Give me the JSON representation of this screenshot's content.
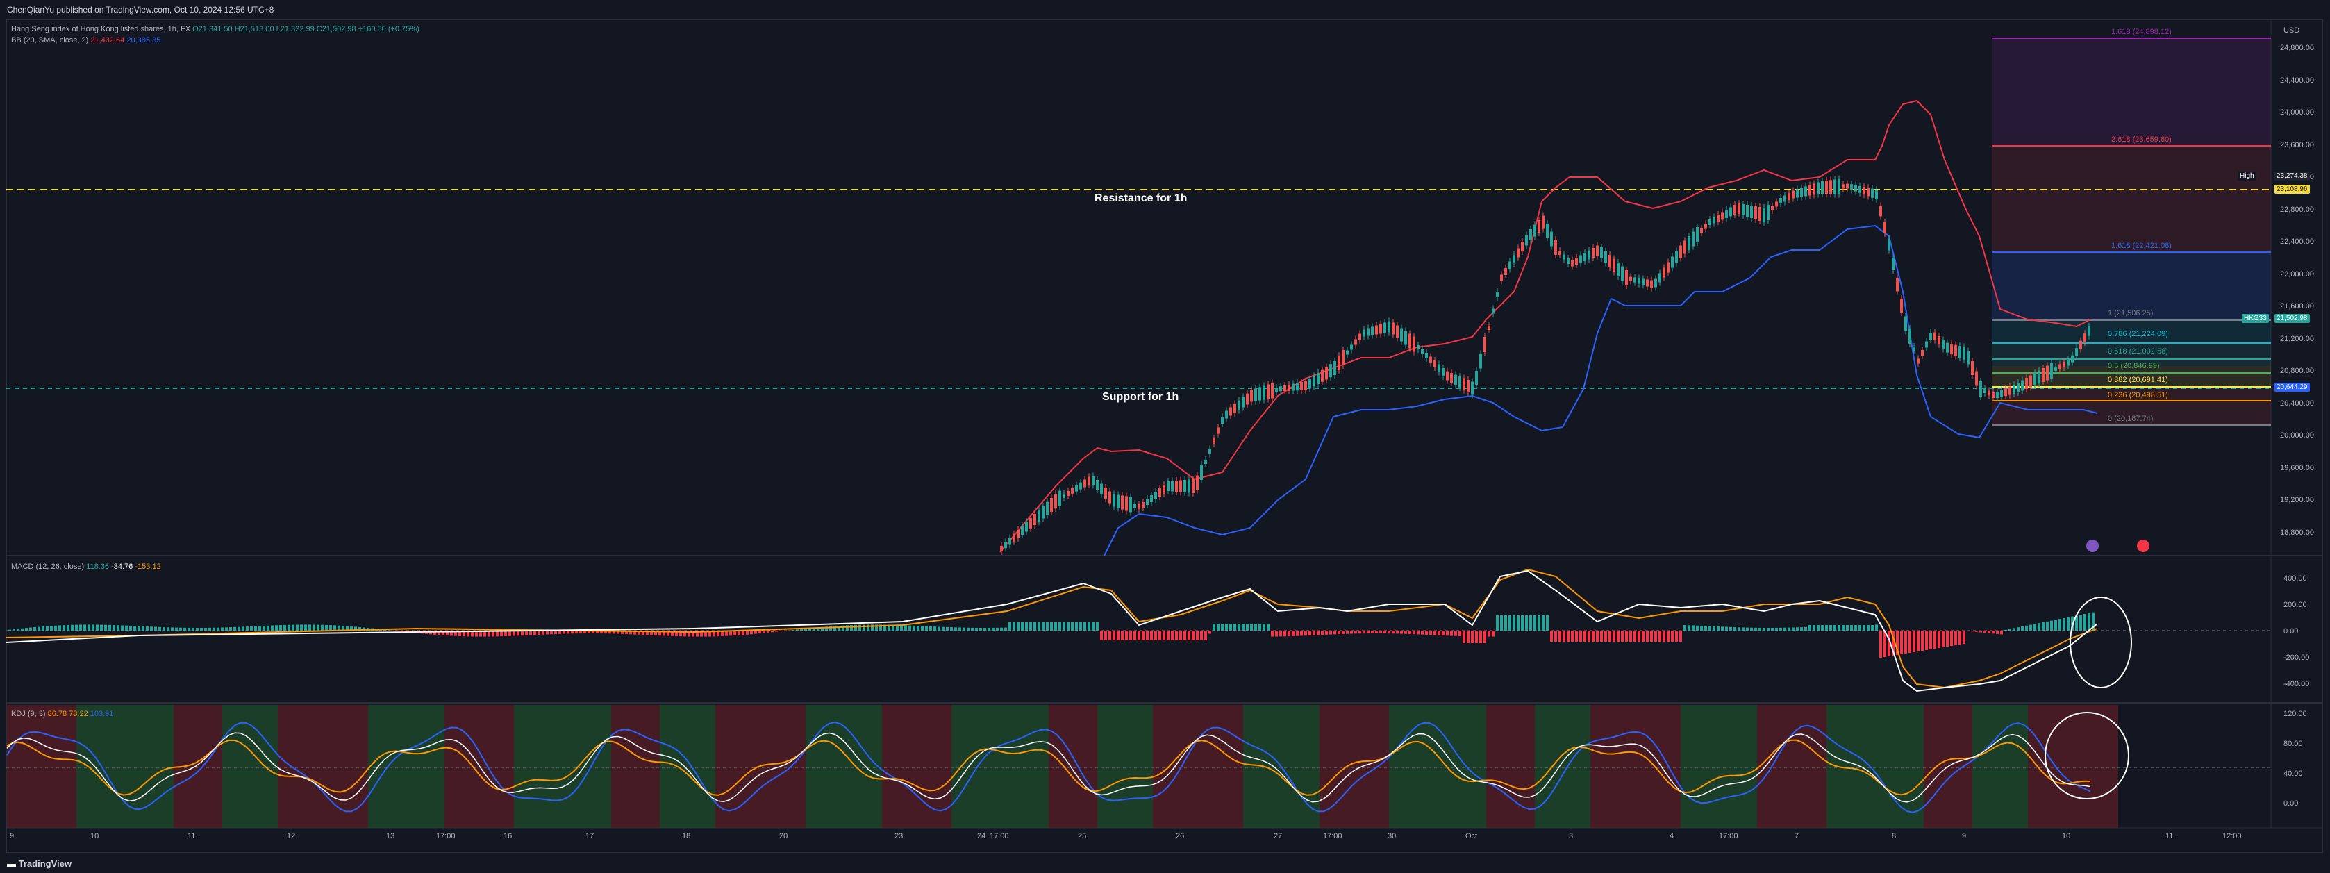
{
  "header": {
    "published": "ChenQianYu published on TradingView.com, Oct 10, 2024 12:56 UTC+8"
  },
  "symbol": {
    "name": "Hang Seng index of Hong Kong listed shares, 1h, FX",
    "open": "O21,341.50",
    "high": "H21,513.00",
    "low": "L21,322.99",
    "close": "C21,502.98",
    "change": "+160.50 (+0.75%)"
  },
  "bb": {
    "label": "BB (20, SMA, close, 2)",
    "upper": "21,432.64",
    "lower": "20,385.35"
  },
  "macd": {
    "label": "MACD (12, 26, close)",
    "hist": "118.36",
    "macd": "-34.76",
    "signal": "-153.12"
  },
  "kdj": {
    "label": "KDJ (9, 3)",
    "k": "86.78",
    "d": "78.22",
    "j": "103.91"
  },
  "currency": "USD",
  "price_axis": [
    "24,800.00",
    "24,400.00",
    "24,000.00",
    "23,600.00",
    "23,200.00",
    "22,800.00",
    "22,400.00",
    "22,000.00",
    "21,600.00",
    "21,200.00",
    "20,800.00",
    "20,400.00",
    "20,000.00",
    "19,600.00",
    "19,200.00",
    "18,800.00"
  ],
  "macd_axis": [
    "400.00",
    "200.00",
    "0.00",
    "-200.00",
    "-400.00"
  ],
  "kdj_axis": [
    "120.00",
    "80.00",
    "40.00",
    "0.00"
  ],
  "time_axis": [
    "9",
    "10",
    "11",
    "12",
    "13",
    "17:00",
    "16",
    "17",
    "18",
    "20",
    "23",
    "17:00",
    "24",
    "25",
    "26",
    "27",
    "17:00",
    "30",
    "Oct",
    "3",
    "4",
    "17:00",
    "7",
    "8",
    "9",
    "10",
    "11",
    "12:00"
  ],
  "tags": {
    "high_label": "High",
    "high_value": "23,274.38",
    "yellow": "23,108.96",
    "symbol_tag": "HKG33",
    "symbol_price": "21,502.98",
    "support_price": "20,644.29"
  },
  "annotations": {
    "resistance": "Resistance for 1h",
    "support": "Support for 1h"
  },
  "fib_levels": [
    {
      "label": "1.618 (24,898.12)",
      "color": "#9c27b0"
    },
    {
      "label": "2.618 (23,659.60)",
      "color": "#f23645"
    },
    {
      "label": "1.618 (22,421.08)",
      "color": "#2962ff"
    },
    {
      "label": "1 (21,506.25)",
      "color": "#787b86"
    },
    {
      "label": "0.786 (21,224.09)",
      "color": "#00bcd4"
    },
    {
      "label": "0.618 (21,002.58)",
      "color": "#26a69a"
    },
    {
      "label": "0.5 (20,846.99)",
      "color": "#4caf50"
    },
    {
      "label": "0.382 (20,691.41)",
      "color": "#ffeb3b"
    },
    {
      "label": "0.236 (20,498.51)",
      "color": "#ff9800"
    },
    {
      "label": "0 (20,187.74)",
      "color": "#787b86"
    }
  ],
  "footer": {
    "brand": "TradingView"
  },
  "colors": {
    "background": "#131722",
    "bull": "#26a69a",
    "bear": "#ef5350",
    "resistance": "#f7dc3b"
  }
}
